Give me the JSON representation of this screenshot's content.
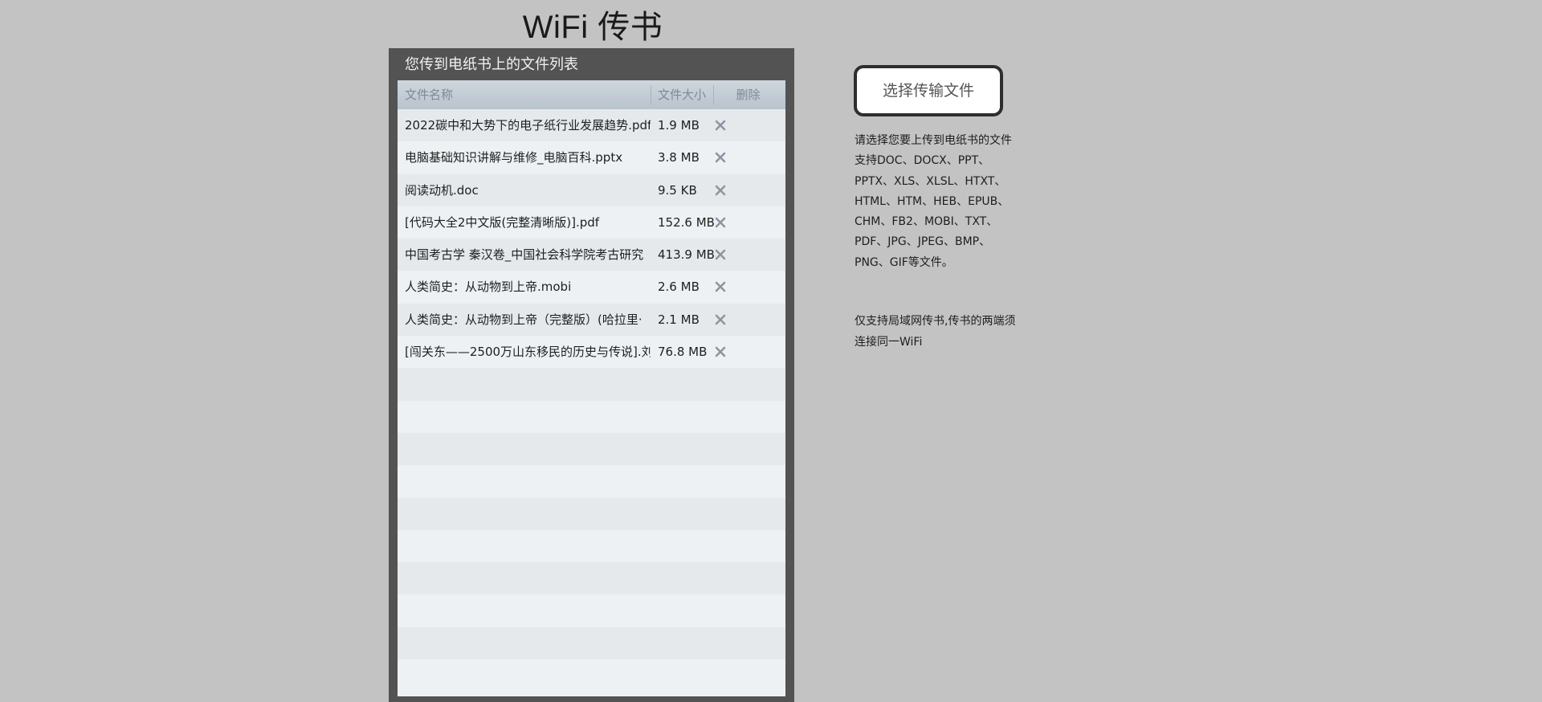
{
  "app_title": "WiFi 传书",
  "panel": {
    "title": "您传到电纸书上的文件列表",
    "columns": {
      "name": "文件名称",
      "size": "文件大小",
      "delete": "删除"
    },
    "files": [
      {
        "name": "2022碳中和大势下的电子纸行业发展趋势.pdf",
        "size": "1.9 MB",
        "delete_icon": "close-icon"
      },
      {
        "name": "电脑基础知识讲解与维修_电脑百科.pptx",
        "size": "3.8 MB",
        "delete_icon": "close-icon"
      },
      {
        "name": "阅读动机.doc",
        "size": "9.5 KB",
        "delete_icon": "close-icon"
      },
      {
        "name": "[代码大全2中文版(完整清晰版)].pdf",
        "size": "152.6 MB",
        "delete_icon": "close-icon"
      },
      {
        "name": "中国考古学 秦汉卷_中国社会科学院考古研究",
        "size": "413.9 MB",
        "delete_icon": "close-icon"
      },
      {
        "name": "人类简史：从动物到上帝.mobi",
        "size": "2.6 MB",
        "delete_icon": "close-icon"
      },
      {
        "name": "人类简史：从动物到上帝（完整版）(哈拉里·",
        "size": "2.1 MB",
        "delete_icon": "close-icon"
      },
      {
        "name": "[闯关东——2500万山东移民的历史与传说].刘",
        "size": "76.8 MB",
        "delete_icon": "close-icon"
      }
    ],
    "empty_rows": 10
  },
  "upload_button": {
    "label": "选择传输文件"
  },
  "info": {
    "lines": [
      "请选择您要上传到电纸书的文件",
      "支持DOC、DOCX、PPT、",
      "PPTX、XLS、XLSL、HTXT、",
      "HTML、HTM、HEB、EPUB、",
      "CHM、FB2、MOBI、TXT、",
      "PDF、JPG、JPEG、BMP、",
      "PNG、GIF等文件。"
    ]
  },
  "note": {
    "lines": [
      "仅支持局域网传书,传书的两端须",
      "连接同一WiFi"
    ]
  },
  "colors": {
    "page_background": "#c3c3c3",
    "panel_background": "#535353",
    "header_text": "#7e8a96",
    "row_odd": "#e6e9ec",
    "row_even": "#eef1f4",
    "delete_icon": "#8a96a2"
  }
}
